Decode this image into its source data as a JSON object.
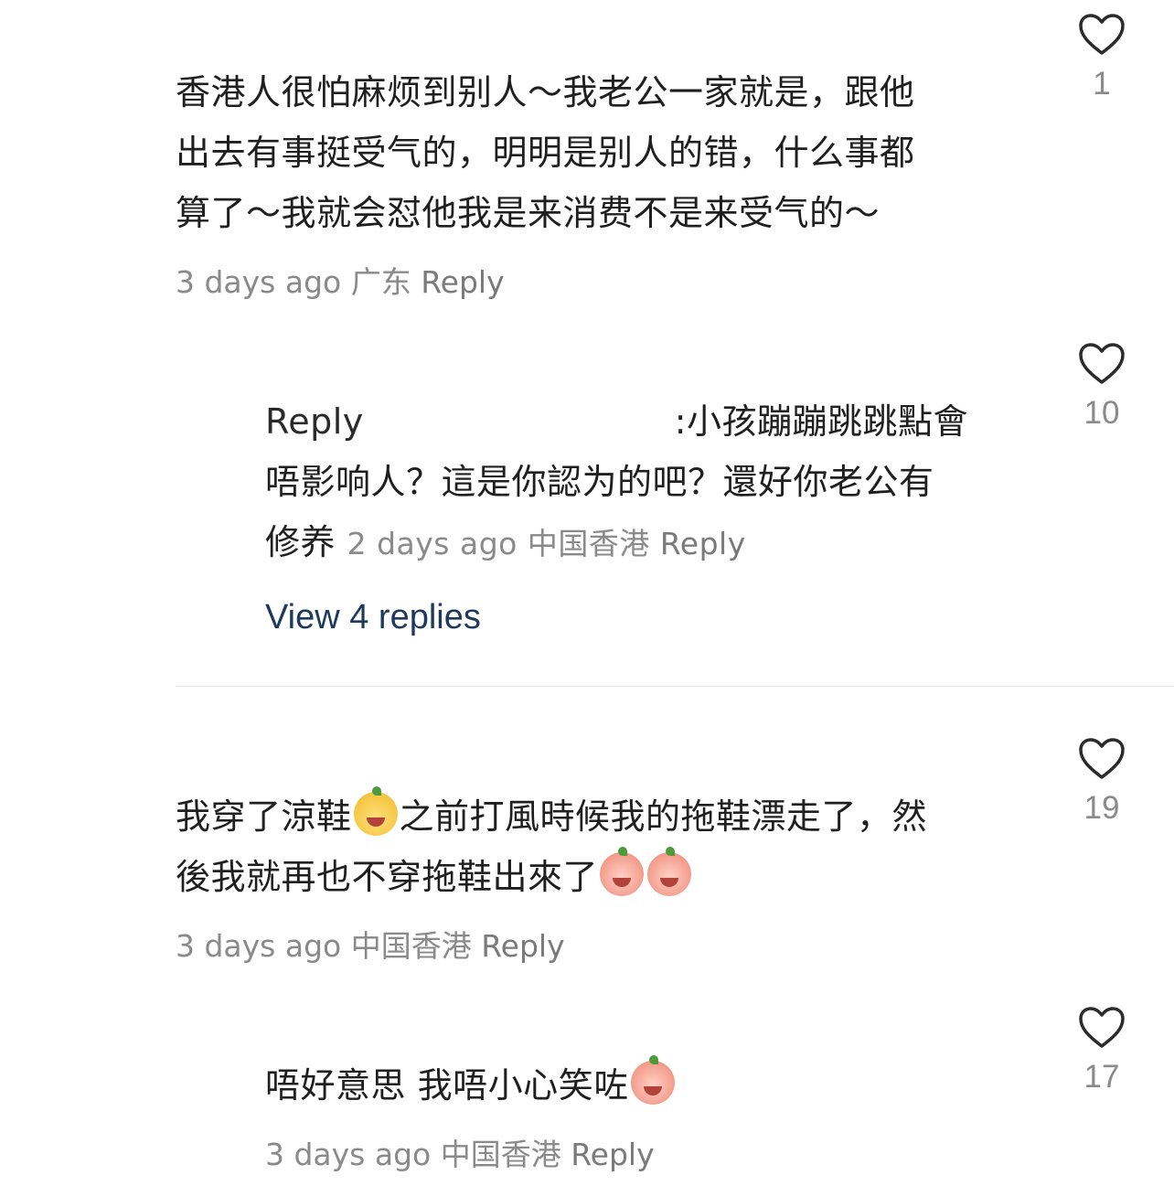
{
  "comments": [
    {
      "text_lines": [
        "香港人很怕麻烦到别人～我老公一家就是，跟他",
        "出去有事挺受气的，明明是别人的错，什么事都",
        "算了～我就会怼他我是来消费不是来受气的～"
      ],
      "time": "3 days ago",
      "location": "广东",
      "reply_label": "Reply",
      "likes": "1"
    },
    {
      "prefix": "Reply",
      "text_lines": [
        ":小孩蹦蹦跳跳點會",
        "唔影响人？這是你認为的吧？還好你老公有",
        "修养"
      ],
      "time": "2 days ago",
      "location": "中国香港",
      "reply_label": "Reply",
      "likes": "10"
    },
    {
      "text_lines": [
        "我穿了涼鞋",
        "之前打風時候我的拖鞋漂走了，然",
        "後我就再也不穿拖鞋出來了"
      ],
      "time": "3 days ago",
      "location": "中国香港",
      "reply_label": "Reply",
      "likes": "19"
    },
    {
      "text_lines": [
        "唔好意思 我唔小心笑咗"
      ],
      "time": "3 days ago",
      "location": "中国香港",
      "reply_label": "Reply",
      "likes": "17"
    }
  ],
  "view_replies": "View 4 replies",
  "colors": {
    "text": "#1f1f1f",
    "meta": "#8a8a8a",
    "link": "#1d3a5c",
    "divider": "#e6e6e6"
  },
  "icons": {
    "like": "heart-outline-icon"
  }
}
